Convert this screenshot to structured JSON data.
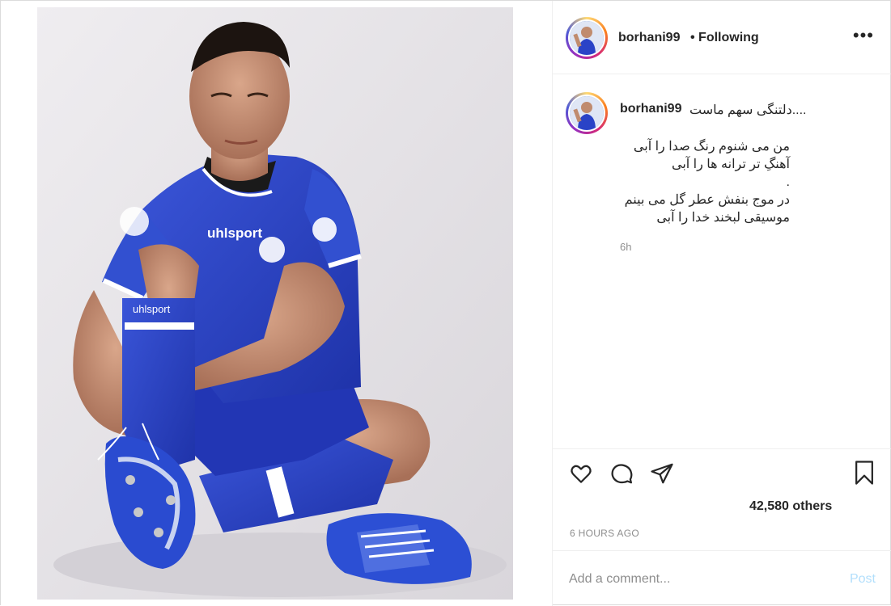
{
  "post": {
    "username": "borhani99",
    "follow_status": "• Following",
    "more_label": "•••",
    "caption": {
      "username": "borhani99",
      "title": "....دلتنگی سهم ماست",
      "lines": [
        "من می شنوم رنگ صدا را آبی",
        "آهنگِ تر ترانه ها را آبی",
        ".",
        "در موج بنفش عطر گل می بینم",
        "موسیقی لبخند خدا را آبی"
      ],
      "time_ago": "6h"
    },
    "likes": "42,580 others",
    "posted_ago": "6 HOURS AGO",
    "comment": {
      "placeholder": "Add a comment...",
      "post_label": "Post"
    },
    "photo": {
      "jersey_text": "uhlsport",
      "sock_text": "uhlsport",
      "jersey_color": "#2a43c7",
      "background_color": "#e6e3e8"
    }
  },
  "colors": {
    "accent_disabled": "#b2dffc",
    "muted": "#8e8e8e",
    "text": "#262626",
    "divider": "#efefef"
  },
  "icons": {
    "like": "heart-icon",
    "comment": "comment-icon",
    "share": "paper-plane-icon",
    "save": "bookmark-icon",
    "more": "more-options-icon"
  }
}
